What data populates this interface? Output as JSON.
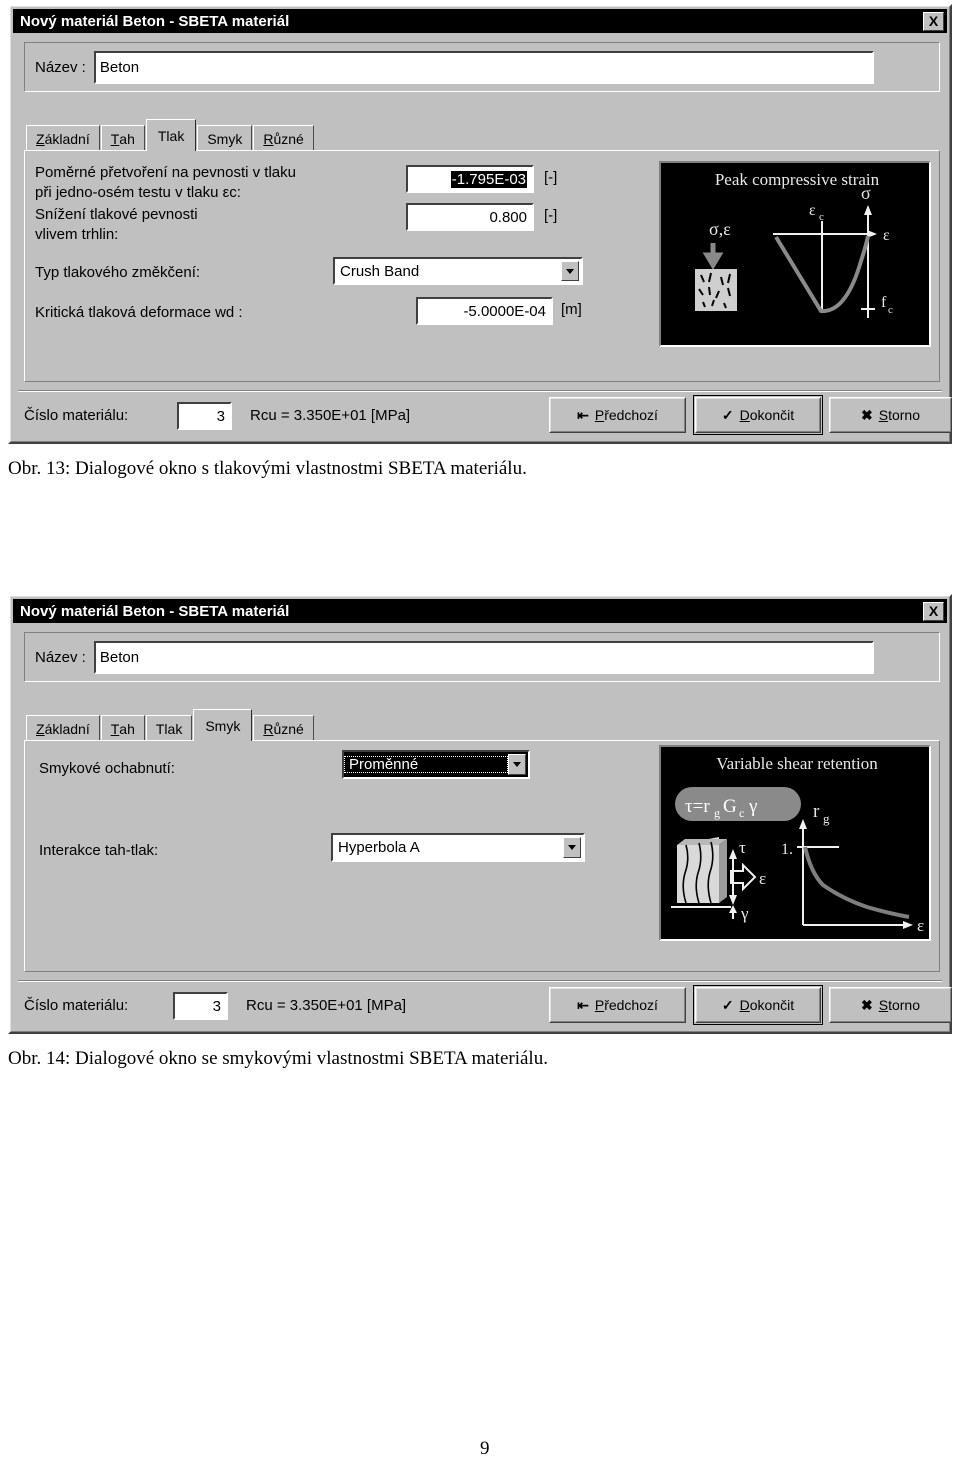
{
  "document": {
    "page_number": "9"
  },
  "dialog1": {
    "title": "Nový materiál Beton - SBETA materiál",
    "close_label": "X",
    "name_label": "Název :",
    "name_value": "Beton",
    "tabs": [
      {
        "label_pre": "Z",
        "label_post": "ákladní",
        "key": "zakladni",
        "active": false
      },
      {
        "label_pre": "T",
        "label_post": "ah",
        "key": "tah",
        "active": false
      },
      {
        "label_pre": "Tl",
        "label_post": "ak",
        "key": "tlak",
        "active": true
      },
      {
        "label_pre": "S",
        "label_post": "myk",
        "key": "smyk",
        "active": false
      },
      {
        "label_pre": "R",
        "label_post": "ůzné",
        "key": "ruzne",
        "active": false
      }
    ],
    "fields": {
      "strain_label_line1": "Poměrné přetvoření na pevnosti v tlaku",
      "strain_label_line2": "při jedno-osém testu v tlaku εc:",
      "strain_value": "-1.795E-03",
      "strain_unit": "[-]",
      "reduction_label_line1": "Snížení tlakové pevnosti",
      "reduction_label_line2": "vlivem trhlin:",
      "reduction_value": "0.800",
      "reduction_unit": "[-]",
      "softening_label": "Typ tlakového změkčení:",
      "softening_value": "Crush Band",
      "critical_label": "Kritická tlaková deformace wd :",
      "critical_value": "-5.0000E-04",
      "critical_unit": "[m]"
    },
    "picture": {
      "title": "Peak compressive strain",
      "label_sigma_eps": "σ,ε",
      "label_eps_c": "εc",
      "label_sigma": "σ",
      "label_eps": "ε",
      "label_fc": "fc"
    },
    "footer": {
      "matnum_label": "Číslo materiálu:",
      "matnum_value": "3",
      "rcu_text": "Rcu = 3.350E+01 [MPa]",
      "prev_icon": "back-arrow-icon",
      "prev_pre": "P",
      "prev_post": "ředchozí",
      "finish_icon": "check-icon",
      "finish_pre": "D",
      "finish_post": "okončit",
      "cancel_icon": "cross-icon",
      "cancel_pre": "S",
      "cancel_post": "torno"
    },
    "caption": "Obr. 13: Dialogové okno s tlakovými vlastnostmi SBETA materiálu."
  },
  "dialog2": {
    "title": "Nový materiál Beton - SBETA materiál",
    "close_label": "X",
    "name_label": "Název :",
    "name_value": "Beton",
    "tabs": [
      {
        "label_pre": "Z",
        "label_post": "ákladní",
        "key": "zakladni",
        "active": false
      },
      {
        "label_pre": "T",
        "label_post": "ah",
        "key": "tah",
        "active": false
      },
      {
        "label_pre": "Tl",
        "label_post": "ak",
        "key": "tlak",
        "active": false
      },
      {
        "label_pre": "S",
        "label_post": "myk",
        "key": "smyk",
        "active": true
      },
      {
        "label_pre": "R",
        "label_post": "ůzné",
        "key": "ruzne",
        "active": false
      }
    ],
    "fields": {
      "shear_label": "Smykové ochabnutí:",
      "shear_value": "Proměnné",
      "interaction_label": "Interakce tah-tlak:",
      "interaction_value": "Hyperbola A"
    },
    "picture": {
      "title": "Variable shear retention",
      "formula": "τ=rg Gc γ",
      "label_tau": "τ",
      "label_eps": "ε",
      "label_gamma": "γ",
      "label_rg": "rg",
      "label_one": "1.",
      "label_eps_axis": "ε"
    },
    "footer": {
      "matnum_label": "Číslo materiálu:",
      "matnum_value": "3",
      "rcu_text": "Rcu = 3.350E+01 [MPa]",
      "prev_icon": "back-arrow-icon",
      "prev_pre": "P",
      "prev_post": "ředchozí",
      "finish_icon": "check-icon",
      "finish_pre": "D",
      "finish_post": "okončit",
      "cancel_icon": "cross-icon",
      "cancel_pre": "S",
      "cancel_post": "torno"
    },
    "caption": "Obr. 14: Dialogové okno se smykovými vlastnostmi SBETA materiálu."
  },
  "colors": {
    "face": "#c0c0c0",
    "titlebar": "#000000",
    "picture_bg": "#000000",
    "picture_fg": "#ffffff",
    "curve": "#808080"
  }
}
